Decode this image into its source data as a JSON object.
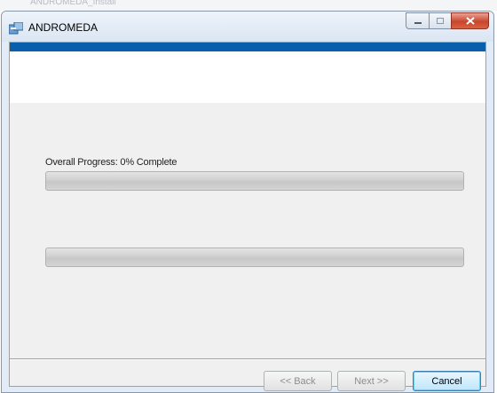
{
  "background_window": {
    "title": "ANDROMEDA_Install"
  },
  "window": {
    "title": "ANDROMEDA",
    "icon": "installer-package-icon",
    "caption_buttons": {
      "minimize_icon": "minimize-icon",
      "maximize_icon": "maximize-icon",
      "close_icon": "close-icon",
      "close_color": "#c9452d"
    }
  },
  "header": {
    "accent_color": "#0a5fac"
  },
  "progress": {
    "label": "Overall Progress: 0% Complete",
    "overall_percent": 0,
    "secondary_percent": 0
  },
  "footer": {
    "back_label": "<< Back",
    "next_label": "Next >>",
    "cancel_label": "Cancel",
    "back_enabled": false,
    "next_enabled": false
  }
}
